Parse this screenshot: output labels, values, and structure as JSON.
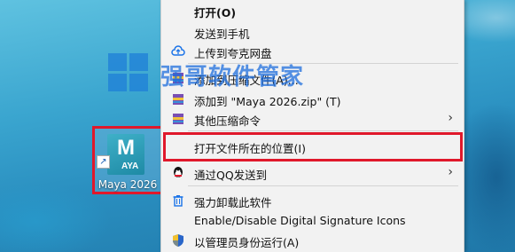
{
  "watermark": {
    "text": "强哥软件管家",
    "logo_icon": "windows-logo-icon"
  },
  "desktop_file": {
    "name": "Maya 2026",
    "icon_letter": "M",
    "icon_subtext": "AYA"
  },
  "menu": {
    "items": [
      {
        "id": "open",
        "label": "打开(O)"
      },
      {
        "id": "send-to-phone",
        "label": "发送到手机"
      },
      {
        "id": "upload-quark",
        "label": "上传到夸克网盘",
        "icon": "cloud-upload-icon"
      },
      {
        "id": "add-archive",
        "label": "添加到压缩文件(A)...",
        "icon": "winrar-icon"
      },
      {
        "id": "add-zip",
        "label": "添加到 \"Maya 2026.zip\" (T)",
        "icon": "winrar-icon"
      },
      {
        "id": "other-compress",
        "label": "其他压缩命令",
        "icon": "winrar-icon",
        "arrow": "›"
      },
      {
        "id": "open-location",
        "label": "打开文件所在的位置(I)"
      },
      {
        "id": "send-qq",
        "label": "通过QQ发送到",
        "icon": "qq-icon",
        "arrow": "›"
      },
      {
        "id": "force-uninstall",
        "label": "强力卸载此软件",
        "icon": "trash-icon"
      },
      {
        "id": "digital-signature",
        "label": "Enable/Disable Digital Signature Icons"
      },
      {
        "id": "run-admin",
        "label": "以管理员身份运行(A)",
        "icon": "uac-shield-icon"
      }
    ]
  },
  "colors": {
    "highlight": "#e0182b",
    "menu_bg": "#f2f2f2"
  }
}
